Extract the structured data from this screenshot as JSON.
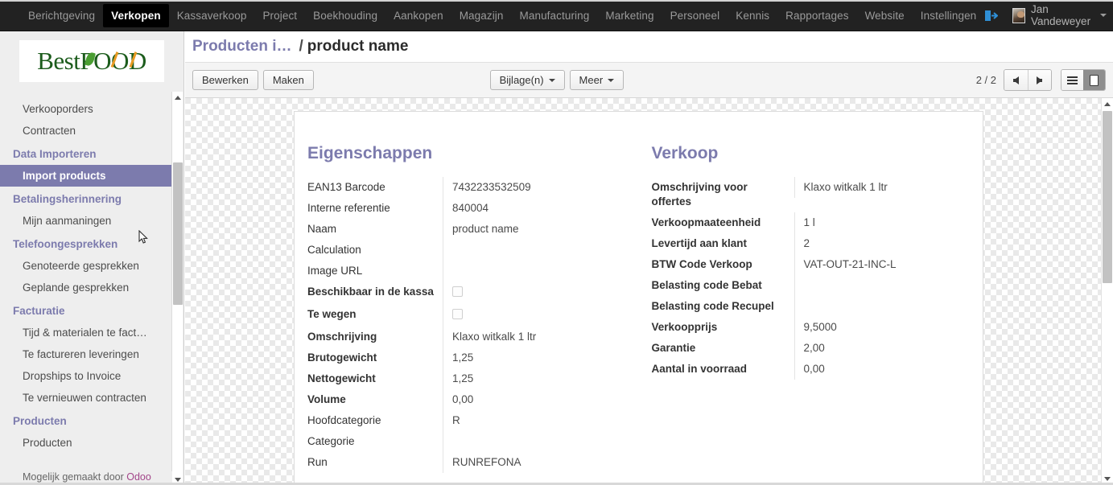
{
  "navbar": {
    "items": [
      {
        "label": "Berichtgeving",
        "active": false
      },
      {
        "label": "Verkopen",
        "active": true
      },
      {
        "label": "Kassaverkoop",
        "active": false
      },
      {
        "label": "Project",
        "active": false
      },
      {
        "label": "Boekhouding",
        "active": false
      },
      {
        "label": "Aankopen",
        "active": false
      },
      {
        "label": "Magazijn",
        "active": false
      },
      {
        "label": "Manufacturing",
        "active": false
      },
      {
        "label": "Marketing",
        "active": false
      },
      {
        "label": "Personeel",
        "active": false
      },
      {
        "label": "Kennis",
        "active": false
      },
      {
        "label": "Rapportages",
        "active": false
      },
      {
        "label": "Website",
        "active": false
      },
      {
        "label": "Instellingen",
        "active": false
      }
    ],
    "login_icon": "sign-in-icon",
    "user_name": "Jan Vandeweyer",
    "user_caret": "chevron-down-icon"
  },
  "sidebar": {
    "logo": {
      "text_part1": "Best",
      "text_part2": "FOOD"
    },
    "entries": [
      {
        "type": "link",
        "label": "Verkooporders",
        "active": false
      },
      {
        "type": "link",
        "label": "Contracten",
        "active": false
      },
      {
        "type": "section",
        "label": "Data Importeren"
      },
      {
        "type": "link",
        "label": "Import products",
        "active": true
      },
      {
        "type": "section",
        "label": "Betalingsherinnering"
      },
      {
        "type": "link",
        "label": "Mijn aanmaningen",
        "active": false
      },
      {
        "type": "section",
        "label": "Telefoongesprekken"
      },
      {
        "type": "link",
        "label": "Genoteerde gesprekken",
        "active": false
      },
      {
        "type": "link",
        "label": "Geplande gesprekken",
        "active": false
      },
      {
        "type": "section",
        "label": "Facturatie"
      },
      {
        "type": "link",
        "label": "Tijd & materialen te fact…",
        "active": false
      },
      {
        "type": "link",
        "label": "Te factureren leveringen",
        "active": false
      },
      {
        "type": "link",
        "label": "Dropships to Invoice",
        "active": false
      },
      {
        "type": "link",
        "label": "Te vernieuwen contracten",
        "active": false
      },
      {
        "type": "section",
        "label": "Producten"
      },
      {
        "type": "link",
        "label": "Producten",
        "active": false
      }
    ],
    "powered_prefix": "Mogelijk gemaakt door ",
    "powered_brand": "Odoo"
  },
  "breadcrumb": {
    "parent": "Producten i…",
    "separator": "/",
    "current": "product name"
  },
  "toolbar": {
    "edit_label": "Bewerken",
    "create_label": "Maken",
    "attachments_label": "Bijlage(n)",
    "more_label": "Meer",
    "pager": "2 / 2",
    "prev_icon": "arrow-left-icon",
    "next_icon": "arrow-right-icon",
    "list_view_icon": "list-view-icon",
    "form_view_icon": "form-view-icon"
  },
  "form": {
    "left": {
      "title": "Eigenschappen",
      "fields": [
        {
          "label": "EAN13 Barcode",
          "value": "7432233532509",
          "bold": false,
          "type": "text"
        },
        {
          "label": "Interne referentie",
          "value": "840004",
          "bold": false,
          "type": "text"
        },
        {
          "label": "Naam",
          "value": "product name",
          "bold": false,
          "type": "text"
        },
        {
          "label": "Calculation",
          "value": "",
          "bold": false,
          "type": "text"
        },
        {
          "label": "Image URL",
          "value": "",
          "bold": false,
          "type": "text"
        },
        {
          "label": "Beschikbaar in de kassa",
          "value": "",
          "bold": true,
          "type": "checkbox",
          "checked": false
        },
        {
          "label": "Te wegen",
          "value": "",
          "bold": true,
          "type": "checkbox",
          "checked": false
        },
        {
          "label": "Omschrijving",
          "value": "Klaxo witkalk 1 ltr",
          "bold": true,
          "type": "text"
        },
        {
          "label": "Brutogewicht",
          "value": "1,25",
          "bold": true,
          "type": "text"
        },
        {
          "label": "Nettogewicht",
          "value": "1,25",
          "bold": true,
          "type": "text"
        },
        {
          "label": "Volume",
          "value": "0,00",
          "bold": true,
          "type": "text"
        },
        {
          "label": "Hoofdcategorie",
          "value": "R",
          "bold": false,
          "type": "text"
        },
        {
          "label": "Categorie",
          "value": "",
          "bold": false,
          "type": "text"
        },
        {
          "label": "Run",
          "value": "RUNREFONA",
          "bold": false,
          "type": "text"
        }
      ]
    },
    "right": {
      "title": "Verkoop",
      "fields": [
        {
          "label": "Omschrijving voor offertes",
          "value": "Klaxo witkalk 1 ltr",
          "bold": true,
          "type": "text"
        },
        {
          "label": "Verkoopmaateenheid",
          "value": "1 l",
          "bold": true,
          "type": "text"
        },
        {
          "label": "Levertijd aan klant",
          "value": "2",
          "bold": true,
          "type": "text"
        },
        {
          "label": "BTW Code Verkoop",
          "value": "VAT-OUT-21-INC-L",
          "bold": true,
          "type": "text"
        },
        {
          "label": "Belasting code Bebat",
          "value": "",
          "bold": true,
          "type": "text"
        },
        {
          "label": "Belasting code Recupel",
          "value": "",
          "bold": true,
          "type": "text"
        },
        {
          "label": "Verkoopprijs",
          "value": "9,5000",
          "bold": true,
          "type": "text"
        },
        {
          "label": "Garantie",
          "value": "2,00",
          "bold": true,
          "type": "text"
        },
        {
          "label": "Aantal in voorraad",
          "value": "0,00",
          "bold": true,
          "type": "text"
        }
      ]
    }
  },
  "colors": {
    "navbar_bg": "#222222",
    "accent_purple": "#7c7bad",
    "sidebar_bg": "#eeeeee",
    "brand_green": "#1c5c1c",
    "brand_orange": "#e89a22",
    "odoo_link": "#a24689"
  }
}
